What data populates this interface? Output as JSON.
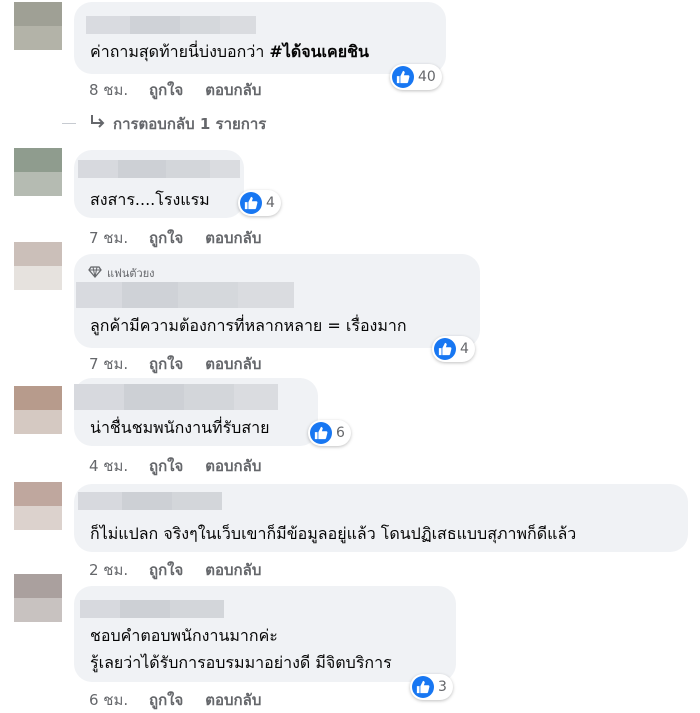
{
  "comments": [
    {
      "time": "8 ชม.",
      "like": "ถูกใจ",
      "reply": "ตอบกลับ",
      "text_lines": [
        "ค่าถามสุดท้ายนี่บ่งบอกว่า "
      ],
      "tag": "#ได้จนเคยชิน",
      "reactions": "40",
      "fan_badge": null,
      "replies_link": "การตอบกลับ 1 รายการ"
    },
    {
      "time": "7 ชม.",
      "like": "ถูกใจ",
      "reply": "ตอบกลับ",
      "text_lines": [
        "สงสาร....โรงแรม"
      ],
      "reactions": "4"
    },
    {
      "time": "7 ชม.",
      "like": "ถูกใจ",
      "reply": "ตอบกลับ",
      "text_lines": [
        "ลูกค้ามีความต้องการที่หลากหลาย = เรื่องมาก"
      ],
      "reactions": "4",
      "fan_badge": "แฟนตัวยง"
    },
    {
      "time": "4 ชม.",
      "like": "ถูกใจ",
      "reply": "ตอบกลับ",
      "text_lines": [
        "น่าชื่นชมพนักงานที่รับสาย"
      ],
      "reactions": "6"
    },
    {
      "time": "2 ชม.",
      "like": "ถูกใจ",
      "reply": "ตอบกลับ",
      "text_lines": [
        "ก็ไม่แปลก จริงๆในเว็บเขาก็มีข้อมูลอยู่แล้ว โดนปฏิเสธแบบสุภาพก็ดีแล้ว"
      ],
      "reactions": null
    },
    {
      "time": "6 ชม.",
      "like": "ถูกใจ",
      "reply": "ตอบกลับ",
      "text_lines": [
        "ชอบคำตอบพนักงานมากค่ะ",
        "รู้เลยว่าได้รับการอบรมมาอย่างดี มีจิตบริการ"
      ],
      "reactions": "3"
    }
  ],
  "icons": {
    "like": "thumbs-up-icon",
    "reply_arrow": "reply-arrow-icon",
    "fan": "diamond-icon"
  },
  "colors": {
    "like_blue": "#1877f2",
    "bubble": "#f0f2f5",
    "meta_grey": "#65676b"
  }
}
